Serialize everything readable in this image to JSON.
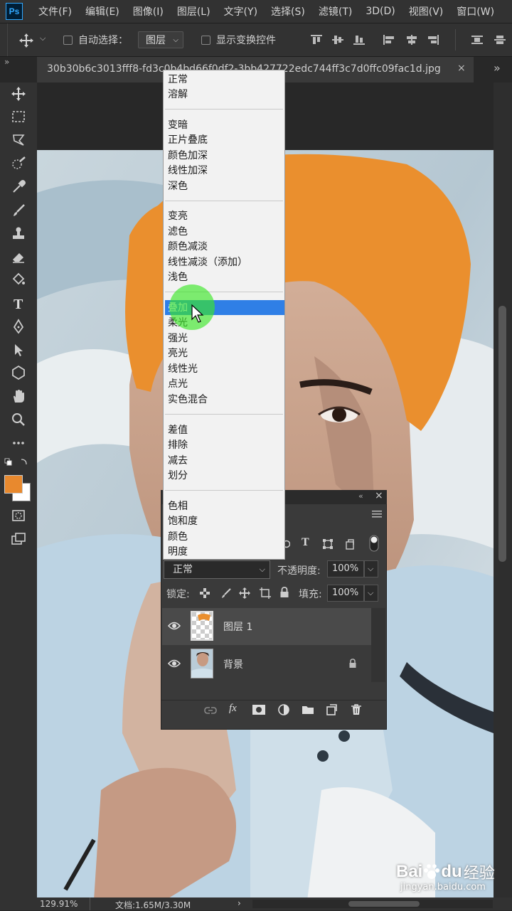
{
  "app": {
    "logo": "Ps"
  },
  "menubar": {
    "items": [
      "文件(F)",
      "编辑(E)",
      "图像(I)",
      "图层(L)",
      "文字(Y)",
      "选择(S)",
      "滤镜(T)",
      "3D(D)",
      "视图(V)",
      "窗口(W)"
    ]
  },
  "options": {
    "auto_select_label": "自动选择：",
    "auto_select_value": "图层",
    "show_transform_label": "显示变换控件"
  },
  "document": {
    "tab_title": "30b30b6c3013fff8-fd3c0b4bd66f0df2-3bb427722edc744ff3c7d0ffc09fac1d.jpg"
  },
  "blend_menu": {
    "items": [
      "正常",
      "溶解",
      "变暗",
      "正片叠底",
      "颜色加深",
      "线性加深",
      "深色",
      "变亮",
      "滤色",
      "颜色减淡",
      "线性减淡（添加）",
      "浅色",
      "叠加",
      "柔光",
      "强光",
      "亮光",
      "线性光",
      "点光",
      "实色混合",
      "差值",
      "排除",
      "减去",
      "划分",
      "色相",
      "饱和度",
      "颜色",
      "明度"
    ],
    "highlighted": "叠加"
  },
  "layers_panel": {
    "blend_mode": "正常",
    "opacity_label": "不透明度:",
    "opacity_value": "100%",
    "lock_label": "锁定:",
    "fill_label": "填充:",
    "fill_value": "100%",
    "layers": [
      {
        "name": "图层 1",
        "visible": true,
        "locked": false,
        "selected": true
      },
      {
        "name": "背景",
        "visible": true,
        "locked": true,
        "selected": false
      }
    ]
  },
  "colors": {
    "foreground": "#e8892e",
    "background": "#ffffff",
    "hair_overlay": "#ea8f2e",
    "highlight": "#2f7fe6"
  },
  "status": {
    "zoom": "129.91%",
    "doc_info": "文档:1.65M/3.30M"
  },
  "watermark": {
    "brand": "Bai",
    "brand2": "du",
    "product": "经验",
    "url": "jingyan.baidu.com"
  }
}
